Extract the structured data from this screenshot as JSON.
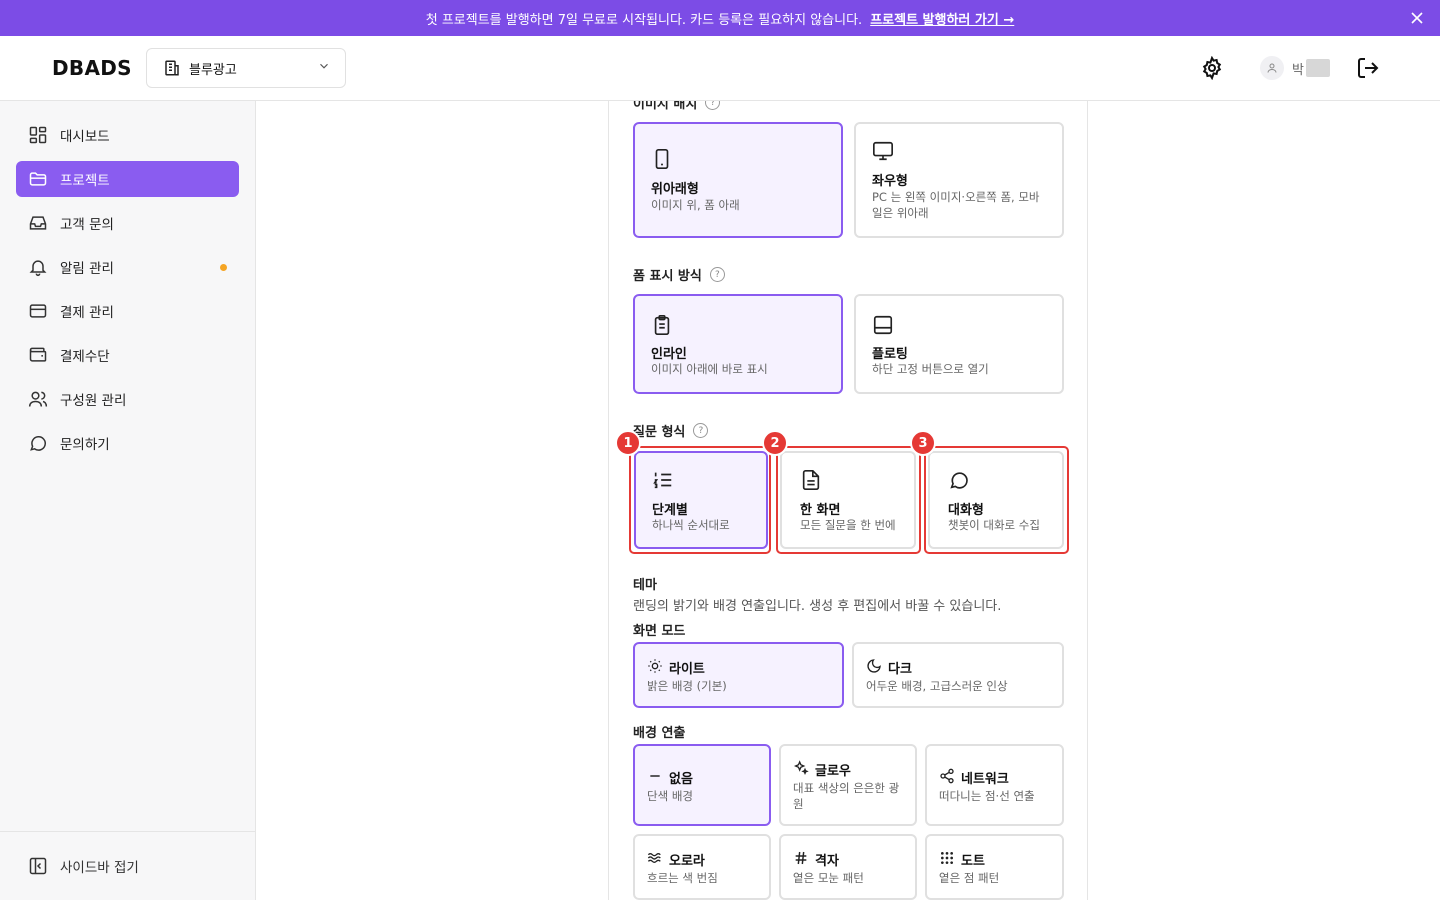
{
  "banner": {
    "text": "첫 프로젝트를 발행하면 7일 무료로 시작됩니다. 카드 등록은 필요하지 않습니다.",
    "cta": "프로젝트 발행하러 가기 →"
  },
  "header": {
    "logo": "DBADS",
    "workspace": "블루광고",
    "user_name": "박"
  },
  "sidebar": {
    "items": [
      {
        "label": "대시보드",
        "icon": "dashboard-icon"
      },
      {
        "label": "프로젝트",
        "icon": "folder-icon",
        "active": true
      },
      {
        "label": "고객 문의",
        "icon": "inbox-icon"
      },
      {
        "label": "알림 관리",
        "icon": "bell-icon",
        "dot": true
      },
      {
        "label": "결제 관리",
        "icon": "card-icon"
      },
      {
        "label": "결제수단",
        "icon": "wallet-icon"
      },
      {
        "label": "구성원 관리",
        "icon": "users-icon"
      },
      {
        "label": "문의하기",
        "icon": "chat-icon"
      }
    ],
    "collapse_label": "사이드바 접기"
  },
  "layout_section": {
    "label": "이미지 배치",
    "options": [
      {
        "title": "위아래형",
        "desc": "이미지 위, 폼 아래",
        "icon": "tablet-icon",
        "selected": true
      },
      {
        "title": "좌우형",
        "desc": "PC 는 왼쪽 이미지·오른쪽 폼, 모바일은 위아래",
        "icon": "monitor-icon",
        "selected": false
      }
    ]
  },
  "form_display": {
    "label": "폼 표시 방식",
    "options": [
      {
        "title": "인라인",
        "desc": "이미지 아래에 바로 표시",
        "icon": "clipboard-icon",
        "selected": true
      },
      {
        "title": "플로팅",
        "desc": "하단 고정 버튼으로 열기",
        "icon": "panel-bottom-icon",
        "selected": false
      }
    ]
  },
  "question_type": {
    "label": "질문 형식",
    "options": [
      {
        "title": "단계별",
        "desc": "하나씩 순서대로",
        "icon": "list-ordered-icon",
        "selected": true,
        "badge": "1"
      },
      {
        "title": "한 화면",
        "desc": "모든 질문을 한 번에",
        "icon": "file-text-icon",
        "selected": false,
        "badge": "2"
      },
      {
        "title": "대화형",
        "desc": "챗봇이 대화로 수집",
        "icon": "message-icon",
        "selected": false,
        "badge": "3"
      }
    ]
  },
  "theme": {
    "title": "테마",
    "desc": "랜딩의 밝기와 배경 연출입니다. 생성 후 편집에서 바꿀 수 있습니다.",
    "mode_label": "화면 모드",
    "modes": [
      {
        "title": "라이트",
        "desc": "밝은 배경 (기본)",
        "icon": "sun-icon",
        "selected": true
      },
      {
        "title": "다크",
        "desc": "어두운 배경, 고급스러운 인상",
        "icon": "moon-icon",
        "selected": false
      }
    ],
    "bg_label": "배경 연출",
    "backgrounds": [
      {
        "title": "없음",
        "desc": "단색 배경",
        "icon": "minus-icon",
        "selected": true
      },
      {
        "title": "글로우",
        "desc": "대표 색상의 은은한 광원",
        "icon": "sparkles-icon",
        "selected": false
      },
      {
        "title": "네트워크",
        "desc": "떠다니는 점·선 연출",
        "icon": "share-icon",
        "selected": false
      },
      {
        "title": "오로라",
        "desc": "흐르는 색 번짐",
        "icon": "waves-icon",
        "selected": false
      },
      {
        "title": "격자",
        "desc": "옅은 모눈 패턴",
        "icon": "hash-icon",
        "selected": false
      },
      {
        "title": "도트",
        "desc": "옅은 점 패턴",
        "icon": "dots-grid-icon",
        "selected": false
      }
    ]
  },
  "colors": {
    "accent": "#8A5CF0",
    "banner": "#7C4CE6",
    "highlight": "#E53935",
    "dot": "#F5A524"
  }
}
